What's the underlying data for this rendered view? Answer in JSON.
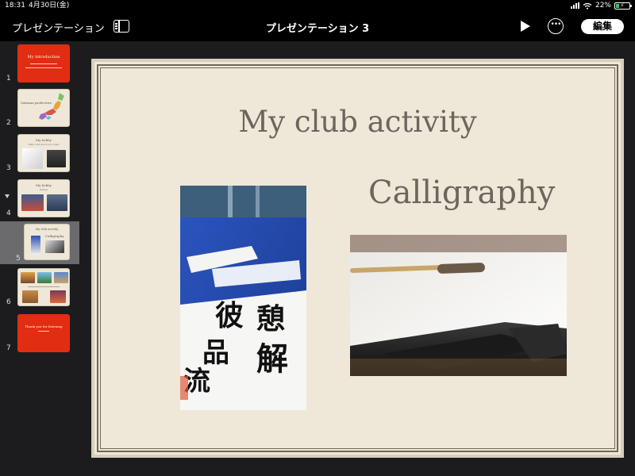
{
  "status": {
    "time": "18:31",
    "date": "4月30日(金)",
    "battery": "22%"
  },
  "toolbar": {
    "back_label": "プレゼンテーション",
    "title": "プレゼンテーション 3",
    "edit_label": "編集",
    "more_label": "•••"
  },
  "slides": [
    {
      "number": "1",
      "title": "My introduction"
    },
    {
      "number": "2",
      "title": "Saitama prefecture"
    },
    {
      "number": "3",
      "title": "My hobby",
      "subtitle": "Piano and electone organ"
    },
    {
      "number": "4",
      "title": "My hobby",
      "subtitle": "Games"
    },
    {
      "number": "5",
      "title": "My club activity",
      "subtitle": "Calligraphy"
    },
    {
      "number": "6",
      "title": ""
    },
    {
      "number": "7",
      "title": "Thank you for listening"
    }
  ],
  "current_slide": {
    "title": "My club activity",
    "subtitle": "Calligraphy"
  },
  "colors": {
    "accent_red": "#e12d12",
    "slide_bg": "#efe8d8",
    "battery_green": "#34c759"
  }
}
